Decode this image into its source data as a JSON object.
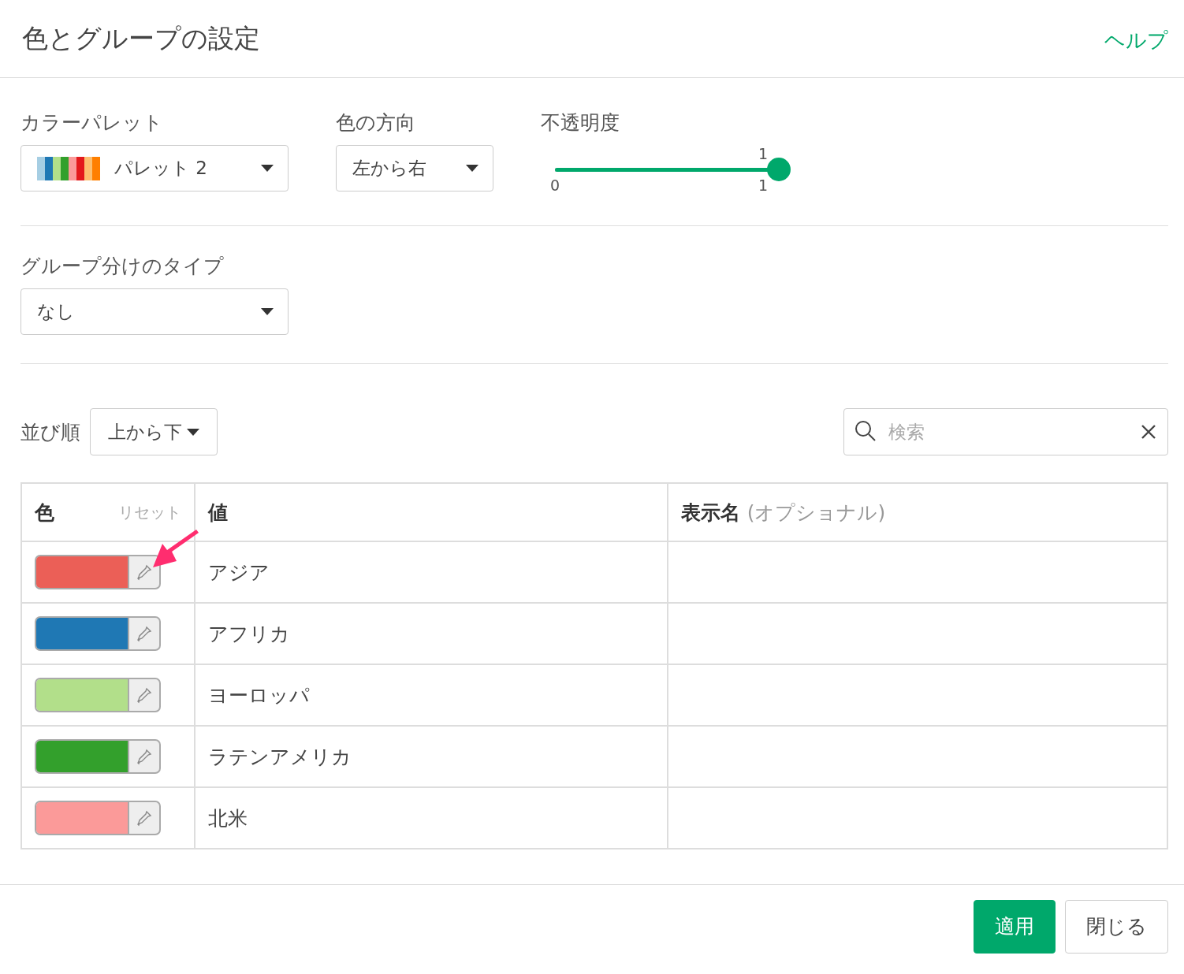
{
  "dialog": {
    "title": "色とグループの設定",
    "help_link": "ヘルプ"
  },
  "color_palette": {
    "label": "カラーパレット",
    "value": "パレット 2",
    "swatch": [
      {
        "color": "#a6cee3"
      },
      {
        "color": "#1f78b4"
      },
      {
        "color": "#b2df8a"
      },
      {
        "color": "#33a02c"
      },
      {
        "color": "#fb9a99"
      },
      {
        "color": "#e31a1c"
      },
      {
        "color": "#fdbf6f"
      },
      {
        "color": "#ff7f00"
      }
    ]
  },
  "color_direction": {
    "label": "色の方向",
    "value": "左から右"
  },
  "opacity": {
    "label": "不透明度",
    "level": 1,
    "current": "1",
    "min": "0",
    "max": "1"
  },
  "grouping_type": {
    "label": "グループ分けのタイプ",
    "value": "なし"
  },
  "sort": {
    "label": "並び順",
    "value": "上から下"
  },
  "search": {
    "placeholder": "検索"
  },
  "table": {
    "columns": [
      {
        "label": "色",
        "action": "リセット"
      },
      {
        "label": "値"
      },
      {
        "label": "表示名",
        "hint": "(オプショナル)"
      }
    ],
    "rows": [
      {
        "color": "#eb5f57",
        "value": "アジア"
      },
      {
        "color": "#1f78b4",
        "value": "アフリカ"
      },
      {
        "color": "#b2df8a",
        "value": "ヨーロッパ"
      },
      {
        "color": "#33a02c",
        "value": "ラテンアメリカ"
      },
      {
        "color": "#fb9a99",
        "value": "北米"
      }
    ]
  },
  "buttons": [
    {
      "label": "適用",
      "kind": "primary"
    },
    {
      "label": "閉じる",
      "kind": "secondary"
    }
  ]
}
